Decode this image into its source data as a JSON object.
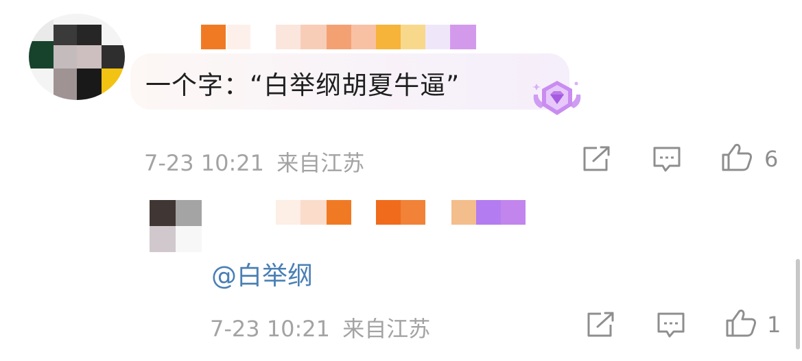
{
  "comment": {
    "text": "一个字：“白举纲胡夏牛逼”",
    "time": "7-23 10:21",
    "location": "来自江苏",
    "like_count": "6",
    "icons": [
      "share-icon",
      "reply-icon",
      "like-icon"
    ],
    "badge_icon": "diamond-badge-icon"
  },
  "reply": {
    "text": "@白举纲",
    "time": "7-23 10:21",
    "location": "来自江苏",
    "like_count": "1",
    "icons": [
      "share-icon",
      "reply-icon",
      "like-icon"
    ]
  },
  "colors": {
    "meta_gray": "#a3a3a3",
    "mention_blue": "#4a7fb5",
    "badge_purple": "#b76ee8",
    "censor_orange": "#f07a24"
  }
}
